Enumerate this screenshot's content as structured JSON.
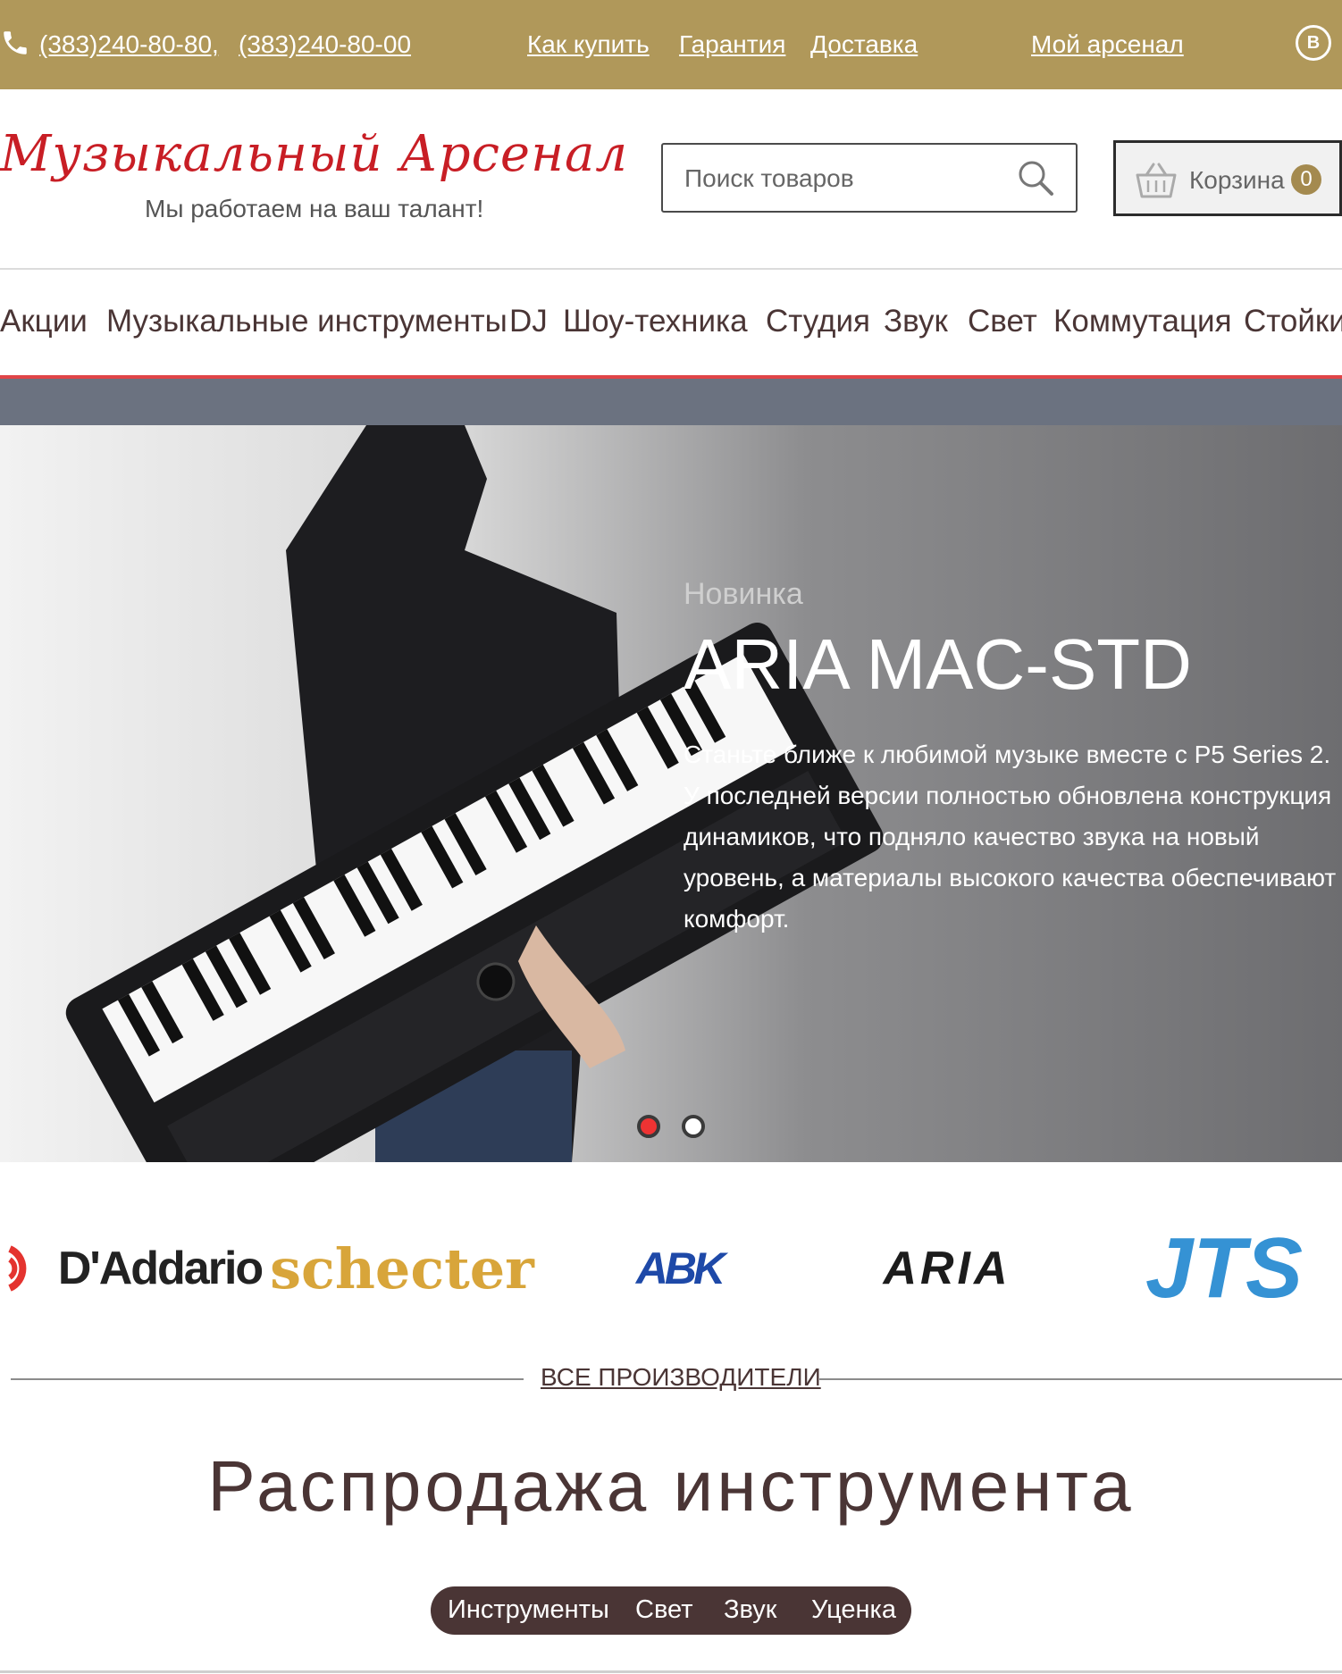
{
  "topbar": {
    "phone_1": "(383)240-80-80,",
    "phone_2": "(383)240-80-00",
    "how_to_buy": "Как купить",
    "warranty": "Гарантия",
    "delivery": "Доставка",
    "my_arsenal": "Мой арсенал",
    "vk_label": "B",
    "icons": [
      "phone-icon",
      "vk-icon"
    ],
    "background_color": "#b0985a"
  },
  "header": {
    "logo_title": "Музыкальный Арсенал",
    "logo_tagline": "Мы работаем на ваш талант!",
    "search_placeholder": "Поиск товаров",
    "cart_label": "Корзина",
    "cart_count": "0",
    "brand_color": "#c81e25"
  },
  "nav": {
    "items": [
      "Акции",
      "Музыкальные инструменты",
      "DJ",
      "Шоу-техника",
      "Студия",
      "Звук",
      "Свет",
      "Коммутация",
      "Стойки"
    ],
    "underline_color": "#e04448"
  },
  "hero": {
    "eyebrow": "Новинка",
    "title": "ARIA MAC-STD",
    "description": "Станьте ближе к любимой музыке вместе с P5 Series 2. У последней версии полностью обновлена конструкция динамиков, что подняло качество звука на новый уровень, а материалы высокого качества обеспечивают комфорт.",
    "slides_total": 2,
    "active_slide": 1
  },
  "brands": {
    "items": [
      "D'Addario",
      "schecter",
      "ABK",
      "ARIA",
      "JTS"
    ],
    "all_link": "ВСЕ ПРОИЗВОДИТЕЛИ"
  },
  "sale": {
    "title": "Распродажа инструмента",
    "tabs": [
      "Инструменты",
      "Свет",
      "Звук",
      "Уценка"
    ]
  }
}
